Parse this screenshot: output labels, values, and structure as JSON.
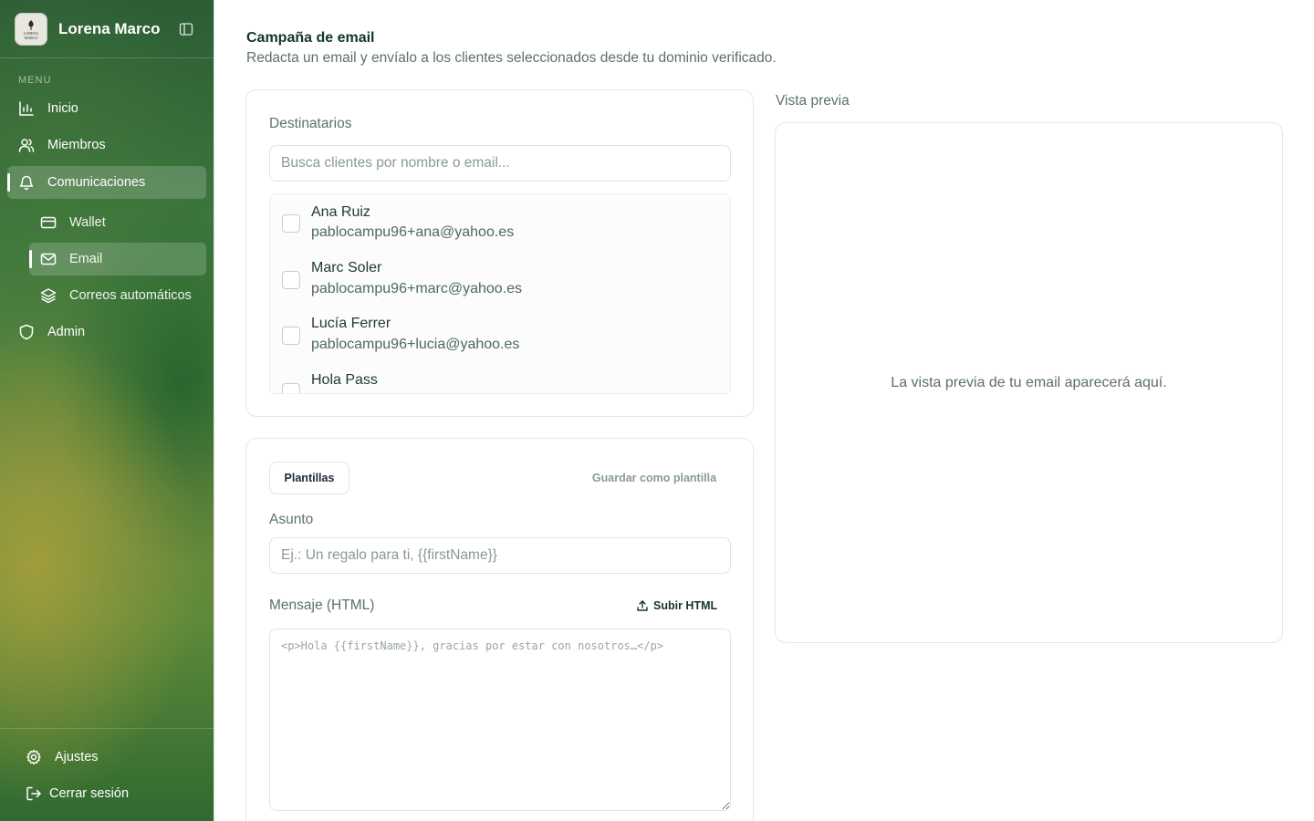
{
  "sidebar": {
    "title": "Lorena Marco",
    "logo_text": "LORENA MARCO",
    "menu_label": "MENU",
    "items": [
      {
        "label": "Inicio",
        "icon": "bar-chart-icon"
      },
      {
        "label": "Miembros",
        "icon": "users-icon"
      },
      {
        "label": "Comunicaciones",
        "icon": "bell-icon",
        "active": true
      },
      {
        "label": "Wallet",
        "icon": "credit-card-icon",
        "sub": true
      },
      {
        "label": "Email",
        "icon": "mail-icon",
        "sub": true,
        "active": true
      },
      {
        "label": "Correos automáticos",
        "icon": "layers-icon",
        "sub": true
      },
      {
        "label": "Admin",
        "icon": "shield-icon"
      }
    ],
    "footer": {
      "settings": "Ajustes",
      "logout": "Cerrar sesión"
    }
  },
  "page": {
    "title": "Campaña de email",
    "subtitle": "Redacta un email y envíalo a los clientes seleccionados desde tu dominio verificado."
  },
  "recipients": {
    "label": "Destinatarios",
    "search_placeholder": "Busca clientes por nombre o email...",
    "clients": [
      {
        "name": "Ana Ruiz",
        "email": "pablocampu96+ana@yahoo.es",
        "checked": false
      },
      {
        "name": "Marc Soler",
        "email": "pablocampu96+marc@yahoo.es",
        "checked": false
      },
      {
        "name": "Lucía Ferrer",
        "email": "pablocampu96+lucia@yahoo.es",
        "checked": false
      },
      {
        "name": "Hola Pass",
        "email": "",
        "checked": false
      }
    ]
  },
  "compose": {
    "templates_button": "Plantillas",
    "save_template_button": "Guardar como plantilla",
    "subject_label": "Asunto",
    "subject_placeholder": "Ej.: Un regalo para ti, {{firstName}}",
    "message_label": "Mensaje (HTML)",
    "upload_button": "Subir HTML",
    "message_placeholder": "<p>Hola {{firstName}}, gracias por estar con nosotros…</p>"
  },
  "preview": {
    "label": "Vista previa",
    "empty_text": "La vista previa de tu email aparecerá aquí."
  },
  "colors": {
    "sidebar_green": "#2f6a30",
    "accent_dark": "#14352a",
    "muted_text": "#5c7268"
  }
}
